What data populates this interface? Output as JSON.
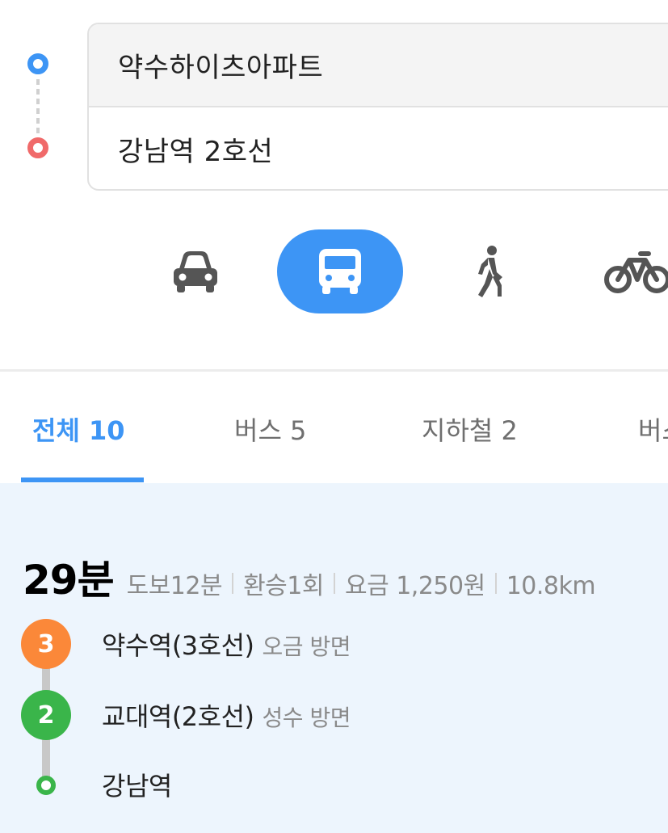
{
  "route": {
    "origin": "약수하이츠아파트",
    "destination": "강남역 2호선"
  },
  "modes": [
    {
      "name": "car",
      "icon": "car-icon",
      "selected": false
    },
    {
      "name": "transit",
      "icon": "bus-icon",
      "selected": true
    },
    {
      "name": "walk",
      "icon": "walk-icon",
      "selected": false
    },
    {
      "name": "bike",
      "icon": "bike-icon",
      "selected": false
    }
  ],
  "tabs": [
    {
      "label": "전체 10",
      "active": true
    },
    {
      "label": "버스 5",
      "active": false
    },
    {
      "label": "지하철 2",
      "active": false
    },
    {
      "label": "버스",
      "active": false
    }
  ],
  "result": {
    "duration": "29분",
    "walk": "도보12분",
    "transfers": "환승1회",
    "fare": "요금 1,250원",
    "distance": "10.8km",
    "steps": [
      {
        "line": "3",
        "color": "#fb8839",
        "station": "약수역(3호선)",
        "direction": "오금 방면"
      },
      {
        "line": "2",
        "color": "#3ab54a",
        "station": "교대역(2호선)",
        "direction": "성수 방면"
      },
      {
        "line": "",
        "color": "#3ab54a",
        "station": "강남역",
        "direction": ""
      }
    ]
  },
  "colors": {
    "accent": "#3d95f5",
    "origin_dot": "#3d95f5",
    "destination_dot": "#f06a6a",
    "result_bg": "#edf5fd"
  }
}
